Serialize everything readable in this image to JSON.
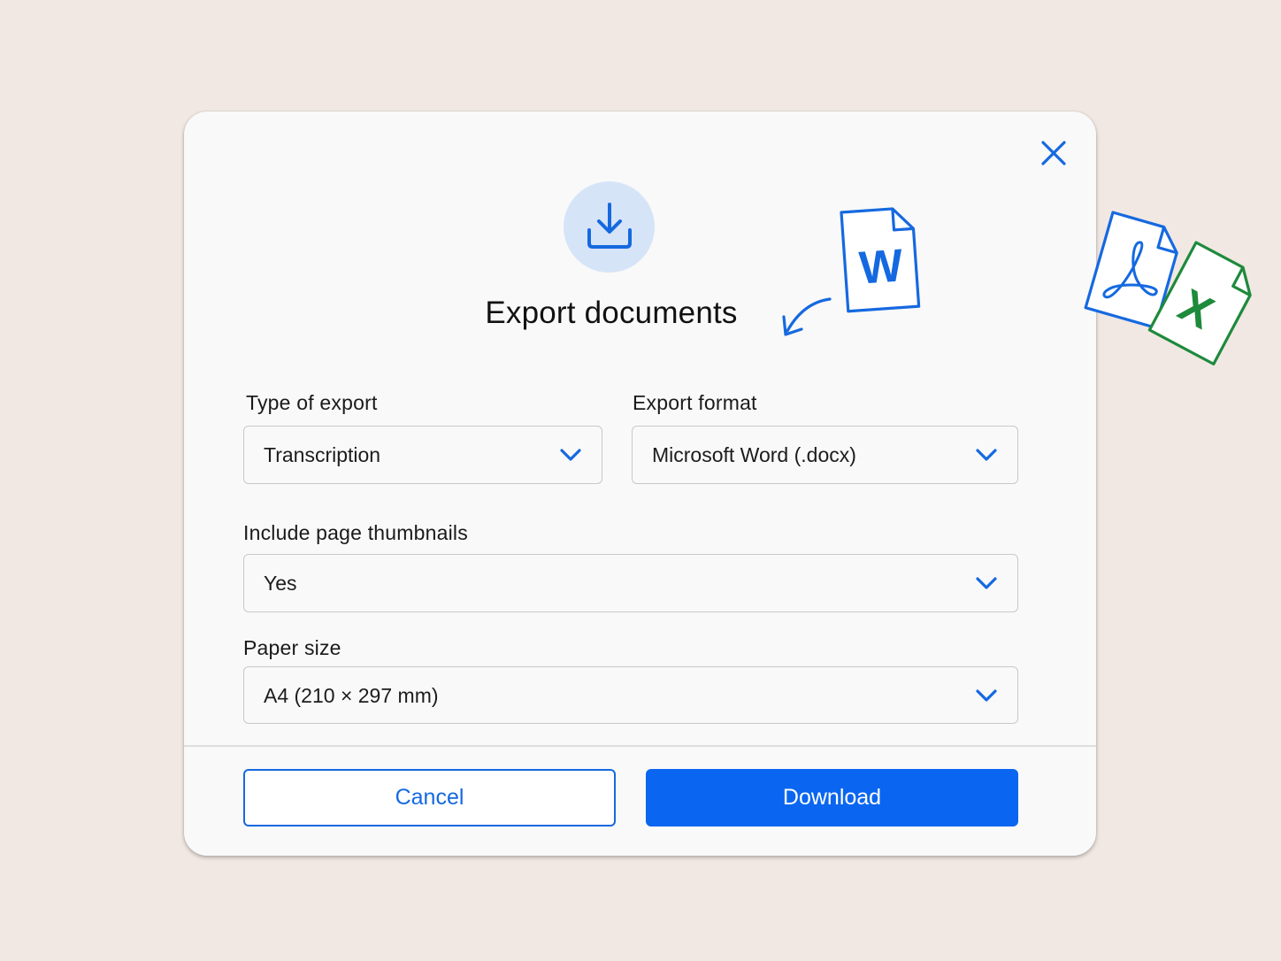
{
  "dialog": {
    "title": "Export documents",
    "close_icon": "close-icon",
    "hero_icon": "download-icon"
  },
  "illustration": {
    "icons": [
      "word-file-icon",
      "pdf-file-icon",
      "excel-file-icon",
      "curved-arrow-icon",
      "sparkle-lines-icon"
    ],
    "word_letter": "W",
    "excel_letter": "X"
  },
  "fields": {
    "type_of_export": {
      "label": "Type of export",
      "value": "Transcription"
    },
    "export_format": {
      "label": "Export format",
      "value": "Microsoft Word (.docx)"
    },
    "include_thumbnails": {
      "label": "Include page thumbnails",
      "value": "Yes"
    },
    "paper_size": {
      "label": "Paper size",
      "value": "A4 (210 × 297 mm)"
    }
  },
  "actions": {
    "cancel_label": "Cancel",
    "download_label": "Download"
  },
  "colors": {
    "accent": "#0a66f0",
    "excel_green": "#1e8a3c",
    "background": "#f1e8e3",
    "dialog": "#f9f9f9"
  }
}
